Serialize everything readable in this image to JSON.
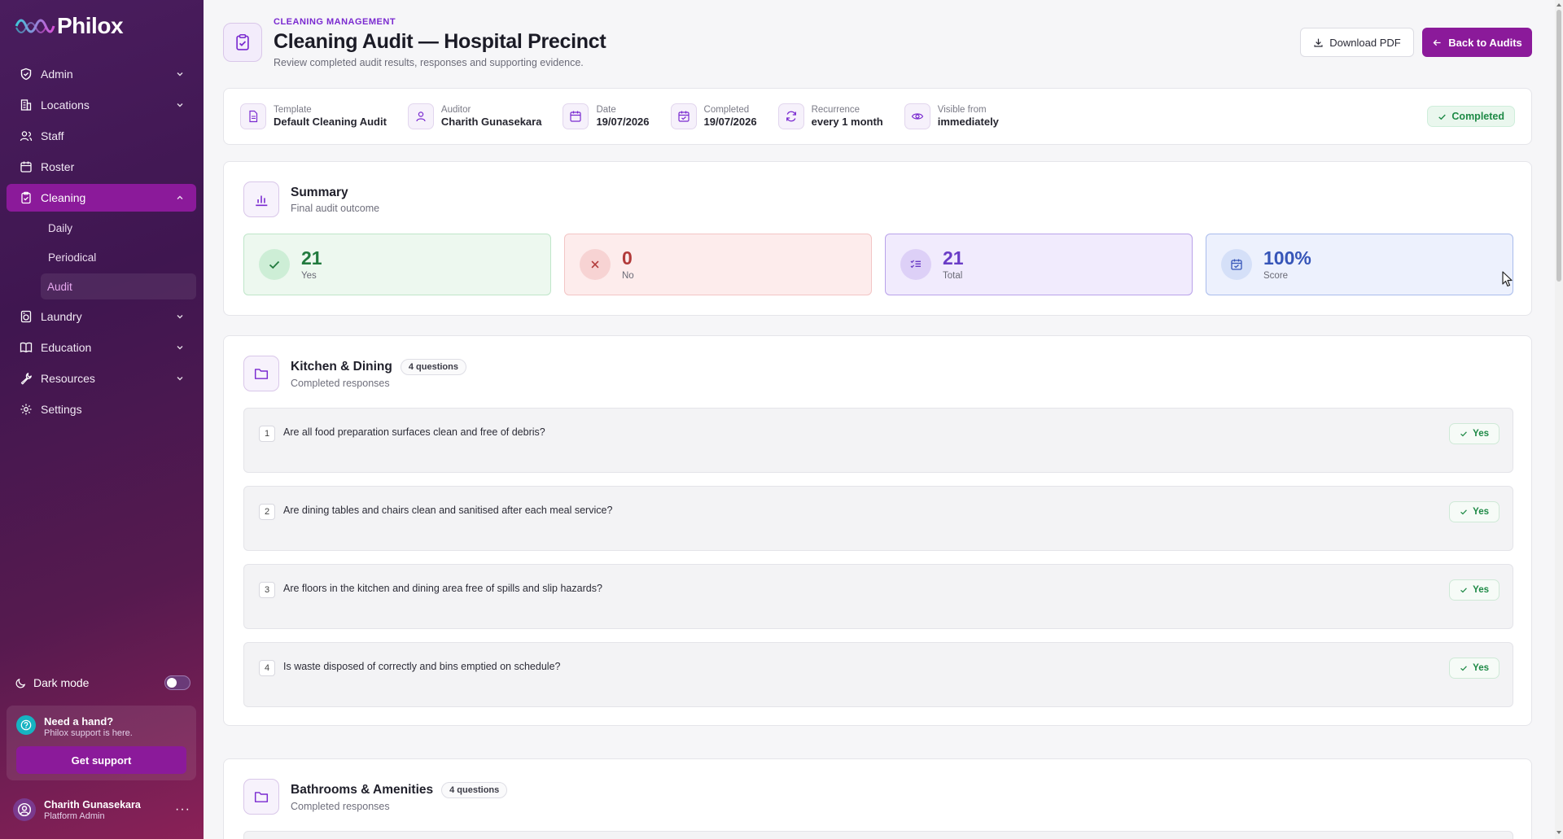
{
  "brand": {
    "name": "Philox"
  },
  "sidebar": {
    "items": [
      {
        "label": "Admin",
        "icon": "shield-icon",
        "expandable": true
      },
      {
        "label": "Locations",
        "icon": "building-icon",
        "expandable": true
      },
      {
        "label": "Staff",
        "icon": "users-icon",
        "expandable": false
      },
      {
        "label": "Roster",
        "icon": "calendar-icon",
        "expandable": false
      },
      {
        "label": "Cleaning",
        "icon": "clipboard-check-icon",
        "expandable": true,
        "active": true,
        "children": [
          {
            "label": "Daily"
          },
          {
            "label": "Periodical"
          },
          {
            "label": "Audit",
            "active": true
          }
        ]
      },
      {
        "label": "Laundry",
        "icon": "washing-machine-icon",
        "expandable": true
      },
      {
        "label": "Education",
        "icon": "book-icon",
        "expandable": true
      },
      {
        "label": "Resources",
        "icon": "wrench-icon",
        "expandable": true
      },
      {
        "label": "Settings",
        "icon": "gear-icon",
        "expandable": false
      }
    ],
    "dark_mode": {
      "label": "Dark mode",
      "enabled": false
    },
    "help": {
      "title": "Need a hand?",
      "subtitle": "Philox support is here.",
      "button": "Get support"
    },
    "user": {
      "name": "Charith Gunasekara",
      "role": "Platform Admin"
    }
  },
  "header": {
    "eyebrow": "CLEANING MANAGEMENT",
    "title": "Cleaning Audit — Hospital Precinct",
    "subtitle": "Review completed audit results, responses and supporting evidence.",
    "download_label": "Download PDF",
    "back_label": "Back to Audits"
  },
  "meta": {
    "template": {
      "label": "Template",
      "value": "Default Cleaning Audit"
    },
    "auditor": {
      "label": "Auditor",
      "value": "Charith Gunasekara"
    },
    "date": {
      "label": "Date",
      "value": "19/07/2026"
    },
    "completed": {
      "label": "Completed",
      "value": "19/07/2026"
    },
    "recurrence": {
      "label": "Recurrence",
      "value": "every 1 month"
    },
    "visible_from": {
      "label": "Visible from",
      "value": "immediately"
    },
    "status": "Completed"
  },
  "summary": {
    "title": "Summary",
    "subtitle": "Final audit outcome",
    "yes": {
      "value": "21",
      "label": "Yes"
    },
    "no": {
      "value": "0",
      "label": "No"
    },
    "total": {
      "value": "21",
      "label": "Total"
    },
    "score": {
      "value": "100%",
      "label": "Score"
    }
  },
  "sections": [
    {
      "title": "Kitchen & Dining",
      "count": "4 questions",
      "subtitle": "Completed responses",
      "questions": [
        {
          "num": "1",
          "text": "Are all food preparation surfaces clean and free of debris?",
          "answer": "Yes"
        },
        {
          "num": "2",
          "text": "Are dining tables and chairs clean and sanitised after each meal service?",
          "answer": "Yes"
        },
        {
          "num": "3",
          "text": "Are floors in the kitchen and dining area free of spills and slip hazards?",
          "answer": "Yes"
        },
        {
          "num": "4",
          "text": "Is waste disposed of correctly and bins emptied on schedule?",
          "answer": "Yes"
        }
      ]
    },
    {
      "title": "Bathrooms & Amenities",
      "count": "4 questions",
      "subtitle": "Completed responses"
    }
  ],
  "colors": {
    "accent": "#8b1a9a",
    "sidebar": "#4a1d5e",
    "success": "#1e8a46"
  }
}
